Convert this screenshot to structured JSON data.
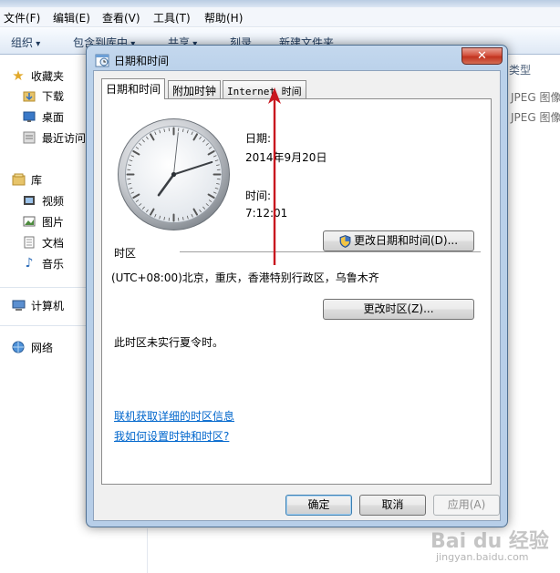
{
  "explorer": {
    "menu": [
      "文件(F)",
      "编辑(E)",
      "查看(V)",
      "工具(T)",
      "帮助(H)"
    ],
    "toolbar": [
      "组织",
      "包含到库中",
      "共享",
      "刻录",
      "新建文件夹"
    ],
    "nav": {
      "favorites": "收藏夹",
      "downloads": "下载",
      "desktop": "桌面",
      "recent": "最近访问",
      "library": "库",
      "video": "视频",
      "pictures": "图片",
      "documents": "文档",
      "music": "音乐",
      "computer": "计算机",
      "network": "网络"
    },
    "type_header": "类型",
    "rows": [
      "JPEG 图像",
      "JPEG 图像"
    ]
  },
  "dialog": {
    "title": "日期和时间",
    "close_glyph": "✕",
    "tabs": [
      "日期和时间",
      "附加时钟",
      "Internet 时间"
    ],
    "date_label": "日期:",
    "date_value": "2014年9月20日",
    "time_label": "时间:",
    "time_value": "7:12:01",
    "change_datetime_btn": "更改日期和时间(D)...",
    "timezone_label": "时区",
    "timezone_value": "(UTC+08:00)北京，重庆，香港特别行政区，乌鲁木齐",
    "change_timezone_btn": "更改时区(Z)...",
    "dst_note": "此时区未实行夏令时。",
    "link_online": "联机获取详细的时区信息",
    "link_howto": "我如何设置时钟和时区?",
    "ok": "确定",
    "cancel": "取消",
    "apply": "应用(A)"
  },
  "watermark": {
    "brand": "Bai du 经验",
    "url": "jingyan.baidu.com"
  },
  "colors": {
    "annotation_arrow": "#c8171e",
    "link": "#0066cc",
    "dialog_frame": "#b7cee8"
  }
}
